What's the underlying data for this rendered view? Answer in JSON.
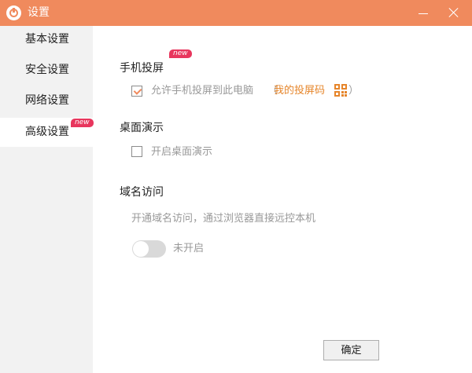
{
  "window": {
    "title": "设置"
  },
  "sidebar": {
    "items": [
      {
        "label": "基本设置"
      },
      {
        "label": "安全设置"
      },
      {
        "label": "网络设置"
      },
      {
        "label": "高级设置",
        "active": true,
        "badge": "new"
      }
    ]
  },
  "sections": {
    "projection": {
      "title": "手机投屏",
      "badge": "new",
      "option_label": "允许手机投屏到此电脑",
      "option_checked": true,
      "paren_open": "（",
      "code_link": "我的投屏码",
      "code_icon": "qr-code-icon",
      "paren_close": "）"
    },
    "desktop_demo": {
      "title": "桌面演示",
      "option_label": "开启桌面演示",
      "option_checked": false
    },
    "domain_access": {
      "title": "域名访问",
      "description": "开通域名访问，通过浏览器直接远控本机",
      "toggle_on": false,
      "toggle_label": "未开启"
    }
  },
  "footer": {
    "ok_label": "确定"
  },
  "colors": {
    "accent": "#f08a5d",
    "badge": "#e8365d",
    "link": "#e6852a",
    "sidebar_bg": "#f2f2f2"
  }
}
